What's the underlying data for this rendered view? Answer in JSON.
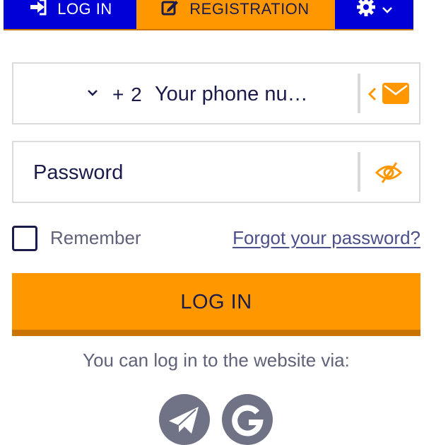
{
  "tabs": {
    "login_label": "LOG IN",
    "registration_label": "REGISTRATION",
    "login_icon": "sign-in-icon",
    "registration_icon": "edit-icon",
    "settings_icon": "gear-icon"
  },
  "phone_field": {
    "country_code": "+ 2",
    "placeholder": "Your phone nu…",
    "switch_icon": "chevron-left-icon",
    "mail_icon": "envelope-icon"
  },
  "password_field": {
    "placeholder": "Password",
    "toggle_icon": "eye-slash-icon"
  },
  "remember": {
    "label": "Remember",
    "checked": false
  },
  "forgot_link": "Forgot your password?",
  "login_button": "LOG IN",
  "social": {
    "caption": "You can log in to the website via:",
    "providers": [
      "telegram-icon",
      "google-icon"
    ]
  },
  "colors": {
    "primary_blue": "#0000d6",
    "accent_orange": "#ff9800",
    "accent_orange_dark": "#c97400",
    "text_dark": "#1b1b4a",
    "text_muted": "#5f6278",
    "social_grey": "#6f7385"
  }
}
